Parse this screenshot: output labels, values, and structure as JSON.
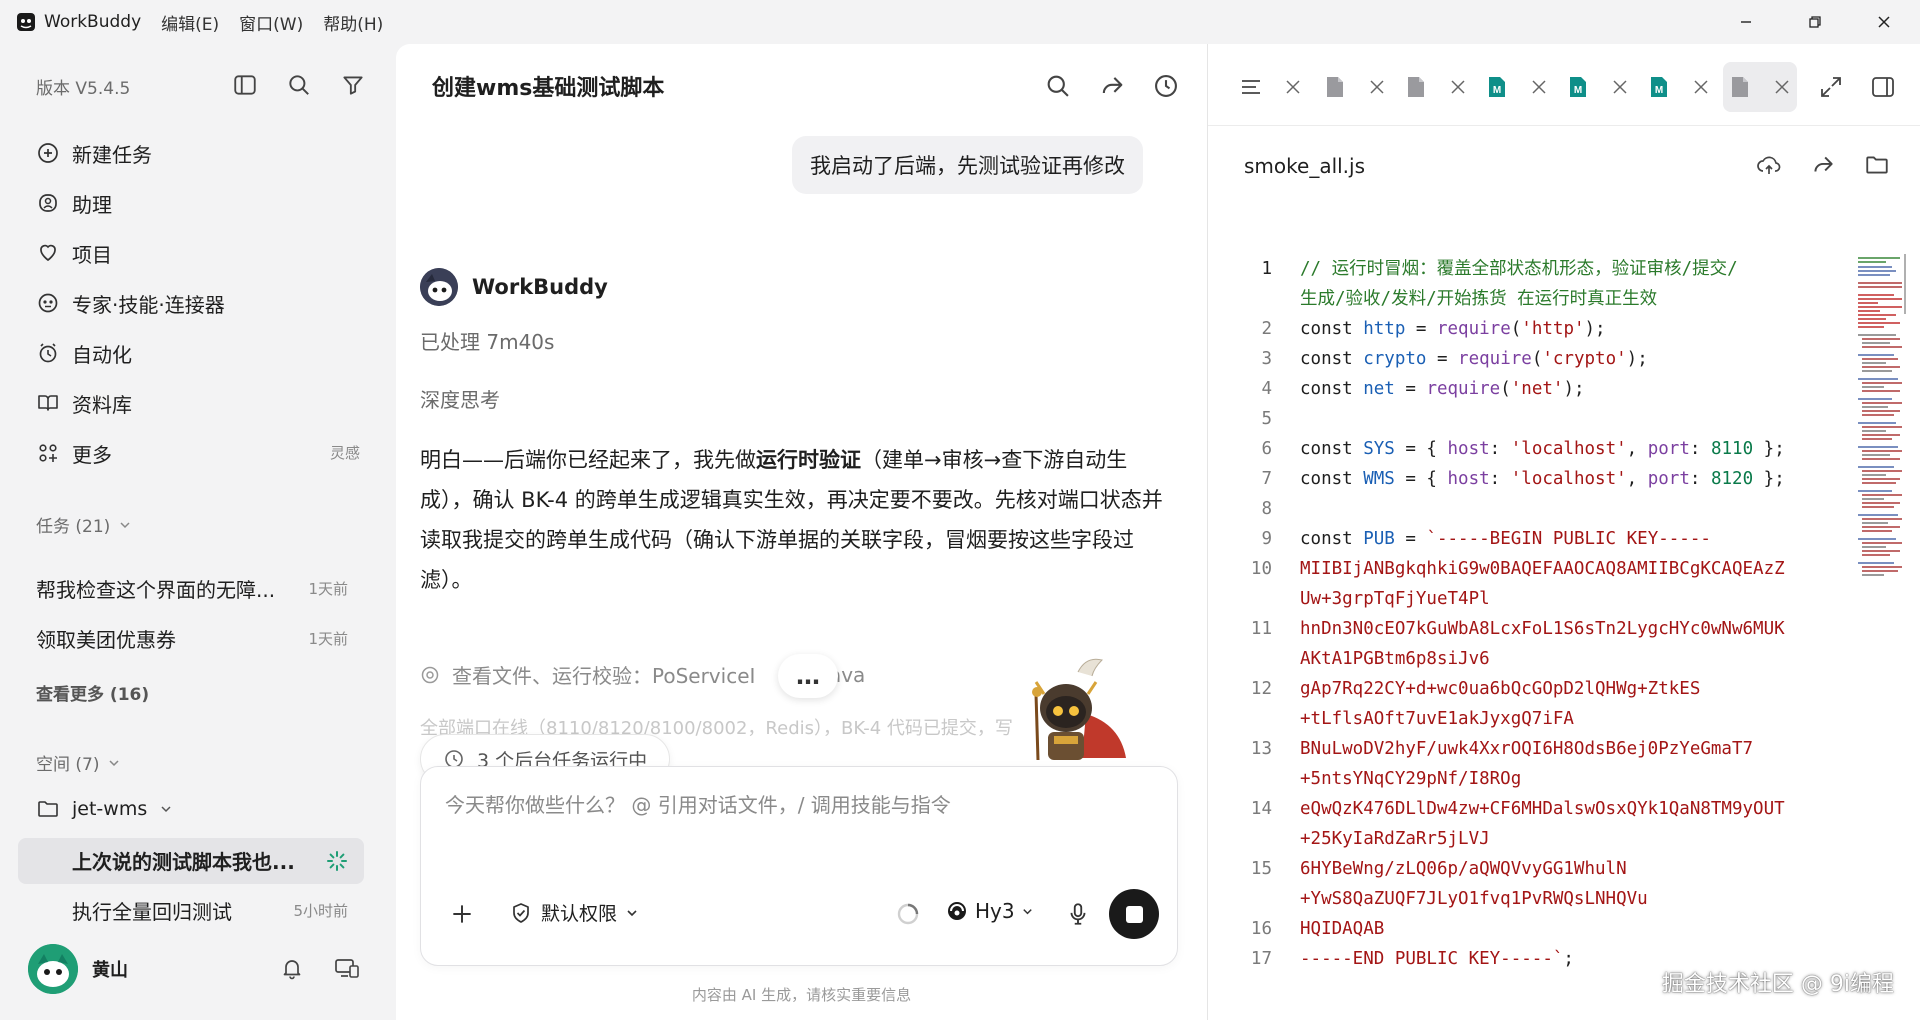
{
  "app": {
    "title": "WorkBuddy",
    "menus": [
      "编辑(E)",
      "窗口(W)",
      "帮助(H)"
    ]
  },
  "sidebar": {
    "version": "版本 V5.4.5",
    "nav": [
      {
        "label": "新建任务",
        "icon": "new-task-icon"
      },
      {
        "label": "助理",
        "icon": "assistant-icon"
      },
      {
        "label": "项目",
        "icon": "project-icon"
      },
      {
        "label": "专家·技能·连接器",
        "icon": "expert-icon"
      },
      {
        "label": "自动化",
        "icon": "automation-icon"
      },
      {
        "label": "资料库",
        "icon": "library-icon"
      },
      {
        "label": "更多",
        "icon": "more-icon"
      }
    ],
    "more_hint": "灵感",
    "tasks_header": "任务 (21)",
    "tasks": [
      {
        "label": "帮我检查这个界面的无障...",
        "time": "1天前"
      },
      {
        "label": "领取美团优惠券",
        "time": "1天前"
      }
    ],
    "see_more": "查看更多 (16)",
    "spaces_header": "空间 (7)",
    "space": "jet-wms",
    "space_tasks": [
      {
        "label": "上次说的测试脚本我也...",
        "time": ""
      },
      {
        "label": "执行全量回归测试",
        "time": "5小时前"
      }
    ],
    "user": "黄山"
  },
  "chat": {
    "title": "创建wms基础测试脚本",
    "user_message": "我启动了后端，先测试验证再修改",
    "bot_name": "WorkBuddy",
    "processed": "已处理 7m40s",
    "deep_think": "深度思考",
    "reply_pre": "明白——后端你已经起来了，我先做",
    "reply_bold": "运行时验证",
    "reply_post": "（建单→审核→查下游自动生成），确认 BK-4 的跨单生成逻辑真实生效，再决定要不要改。先核对端口状态并读取我提交的跨单生成代码（确认下游单据的关联字段，冒烟要按这些字段过滤）。",
    "tool_step": "查看文件、运行校验：PoServiceI",
    "tool_step_tail": "java",
    "faded_text": "全部端口在线（8110/8120/8100/8002，Redis），BK-4 代码已提交，写",
    "bg_tasks": "3 个后台任务运行中",
    "input_placeholder": "今天帮你做些什么？ @ 引用对话文件，/ 调用技能与指令",
    "permission": "默认权限",
    "model": "Hy3",
    "disclaimer": "内容由 AI 生成，请核实重要信息"
  },
  "editor": {
    "filename": "smoke_all.js",
    "tabs": [
      {
        "type": "file",
        "active": false
      },
      {
        "type": "file",
        "active": false
      },
      {
        "type": "md",
        "active": false
      },
      {
        "type": "md",
        "active": false
      },
      {
        "type": "md",
        "active": false
      },
      {
        "type": "file",
        "active": true
      }
    ],
    "code": [
      {
        "n": "1",
        "html": "<span class=\"cm\">// 运行时冒烟：覆盖全部状态机形态，验证审核/提交/</span>"
      },
      {
        "n": "",
        "html": "<span class=\"cm\">生成/验收/发料/开始拣货 在运行时真正生效</span>"
      },
      {
        "n": "2",
        "html": "const <span class=\"vr\">http</span> = <span class=\"fn\">require</span>(<span class=\"st\">'http'</span>);"
      },
      {
        "n": "3",
        "html": "const <span class=\"vr\">crypto</span> = <span class=\"fn\">require</span>(<span class=\"st\">'crypto'</span>);"
      },
      {
        "n": "4",
        "html": "const <span class=\"vr\">net</span> = <span class=\"fn\">require</span>(<span class=\"st\">'net'</span>);"
      },
      {
        "n": "5",
        "html": ""
      },
      {
        "n": "6",
        "html": "const <span class=\"vr\">SYS</span> = { <span class=\"pr\">host</span>: <span class=\"st\">'localhost'</span>, <span class=\"pr\">port</span>: <span class=\"nu\">8110</span> };"
      },
      {
        "n": "7",
        "html": "const <span class=\"vr\">WMS</span> = { <span class=\"pr\">host</span>: <span class=\"st\">'localhost'</span>, <span class=\"pr\">port</span>: <span class=\"nu\">8120</span> };"
      },
      {
        "n": "8",
        "html": ""
      },
      {
        "n": "9",
        "html": "const <span class=\"vr\">PUB</span> = <span class=\"st\">`-----BEGIN PUBLIC KEY-----</span>"
      },
      {
        "n": "10",
        "html": "<span class=\"st\">MIIBIjANBgkqhkiG9w0BAQEFAAOCAQ8AMIIBCgKCAQEAzZ</span>"
      },
      {
        "n": "",
        "html": "<span class=\"st\">Uw+3grpTqFjYueT4Pl</span>"
      },
      {
        "n": "11",
        "html": "<span class=\"st\">hnDn3N0cEO7kGuWbA8LcxFoL1S6sTn2LygcHYc0wNw6MUK</span>"
      },
      {
        "n": "",
        "html": "<span class=\"st\">AKtA1PGBtm6p8siJv6</span>"
      },
      {
        "n": "12",
        "html": "<span class=\"st\">gAp7Rq22CY+d+wc0ua6bQcGOpD2lQHWg+ZtkES</span>"
      },
      {
        "n": "",
        "html": "<span class=\"st\">+tLflsAOft7uvE1akJyxgQ7iFA</span>"
      },
      {
        "n": "13",
        "html": "<span class=\"st\">BNuLwoDV2hyF/uwk4XxrOQI6H8OdsB6ej0PzYeGmaT7</span>"
      },
      {
        "n": "",
        "html": "<span class=\"st\">+5ntsYNqCY29pNf/I8ROg</span>"
      },
      {
        "n": "14",
        "html": "<span class=\"st\">eQwQzK476DLlDw4zw+CF6MHDalswOsxQYk1QaN8TM9yOUT</span>"
      },
      {
        "n": "",
        "html": "<span class=\"st\">+25KyIaRdZaRr5jLVJ</span>"
      },
      {
        "n": "15",
        "html": "<span class=\"st\">6HYBeWng/zLQ06p/aQWQVvyGG1WhulN</span>"
      },
      {
        "n": "",
        "html": "<span class=\"st\">+YwS8QaZUQF7JLyO1fvq1PvRWQsLNHQVu</span>"
      },
      {
        "n": "16",
        "html": "<span class=\"st\">HQIDAQAB</span>"
      },
      {
        "n": "17",
        "html": "<span class=\"st\">-----END PUBLIC KEY-----`</span>;"
      }
    ]
  },
  "watermark": "掘金技术社区 @ 9i编程",
  "colors": {
    "accent": "#1f9e75",
    "string": "#a31515",
    "variable": "#1a5fb4",
    "comment": "#2b7a2b"
  }
}
